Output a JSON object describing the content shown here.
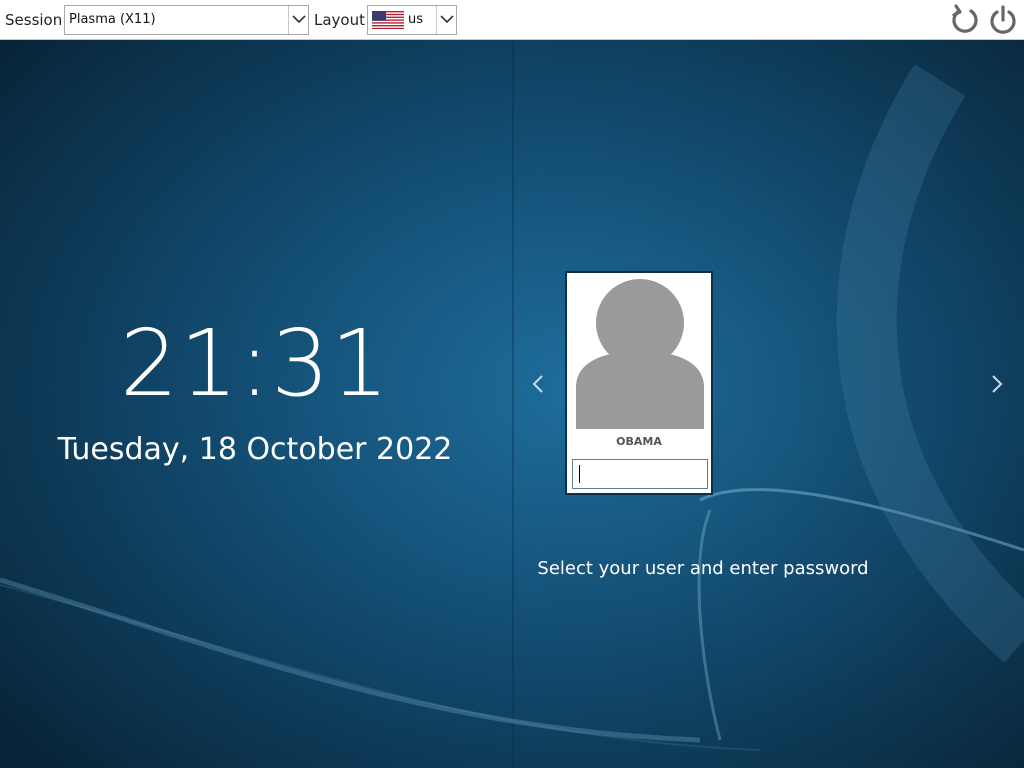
{
  "topbar": {
    "session_label": "Session",
    "session_value": "Plasma (X11)",
    "layout_label": "Layout",
    "layout_value": "us",
    "icons": [
      "reboot-icon",
      "power-icon"
    ]
  },
  "clock": {
    "time": "21:31",
    "date": "Tuesday, 18 October 2022"
  },
  "user_card": {
    "username": "OBAMA",
    "password_value": ""
  },
  "hint": "Select your user and enter password",
  "colors": {
    "background": "#0c3553",
    "topbar": "#ffffff",
    "avatar": "#9a9a9a",
    "text": "#ffffff"
  }
}
